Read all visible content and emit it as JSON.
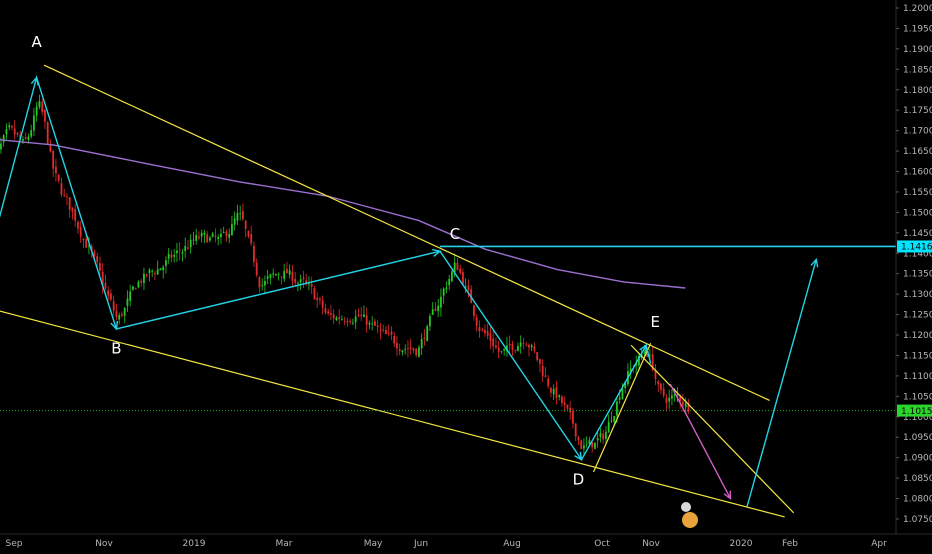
{
  "chart_data": {
    "type": "candlestick",
    "instrument_hint": "",
    "x_ticks": [
      "Sep",
      "Nov",
      "2019",
      "Mar",
      "May",
      "Jun",
      "Aug",
      "Oct",
      "Nov",
      "2020",
      "Feb",
      "Apr"
    ],
    "y_ticks": [
      "1.20000",
      "1.19500",
      "1.19000",
      "1.18500",
      "1.18000",
      "1.17500",
      "1.17000",
      "1.16500",
      "1.16000",
      "1.15500",
      "1.15000",
      "1.14500",
      "1.14000",
      "1.13500",
      "1.13000",
      "1.12500",
      "1.12000",
      "1.11500",
      "1.11000",
      "1.10500",
      "1.10000",
      "1.09500",
      "1.09000",
      "1.08500",
      "1.08000",
      "1.07500"
    ],
    "ylim": [
      1.0735,
      1.202
    ],
    "price_tags": [
      {
        "name": "resistance",
        "value": "1.14167",
        "bg": "#00e5ff",
        "fg": "#000000"
      },
      {
        "name": "last-price",
        "value": "1.10152",
        "bg": "#2bd62b",
        "fg": "#000000"
      }
    ],
    "wave_labels": [
      {
        "text": "A",
        "date": "2018-09-20",
        "price": 1.1905
      },
      {
        "text": "B",
        "date": "2018-11-12",
        "price": 1.1155
      },
      {
        "text": "C",
        "date": "2019-06-25",
        "price": 1.1435
      },
      {
        "text": "D",
        "date": "2019-09-15",
        "price": 1.0835
      },
      {
        "text": "E",
        "date": "2019-11-05",
        "price": 1.122
      }
    ],
    "colors": {
      "background": "#000000",
      "candle_up": "#26c926",
      "candle_down": "#e32c2c",
      "trendline": "#f4e842",
      "wave_path": "#22d3e6",
      "moving_average": "#9b6fd0",
      "projection": "#d35fc4",
      "last_price_line": "#1fa81f",
      "axis_text": "#b7b7b7"
    },
    "moving_average": [
      {
        "date": "2018-08-20",
        "price": 1.168
      },
      {
        "date": "2018-10-01",
        "price": 1.1665
      },
      {
        "date": "2018-12-01",
        "price": 1.162
      },
      {
        "date": "2019-02-01",
        "price": 1.1575
      },
      {
        "date": "2019-04-01",
        "price": 1.154
      },
      {
        "date": "2019-06-01",
        "price": 1.148
      },
      {
        "date": "2019-07-15",
        "price": 1.141
      },
      {
        "date": "2019-09-01",
        "price": 1.136
      },
      {
        "date": "2019-10-15",
        "price": 1.133
      },
      {
        "date": "2019-11-25",
        "price": 1.1315
      }
    ],
    "trendlines": [
      {
        "name": "upper-channel",
        "from": {
          "date": "2018-09-25",
          "price": 1.186
        },
        "to": {
          "date": "2020-01-20",
          "price": 1.104
        }
      },
      {
        "name": "lower-channel",
        "from": {
          "date": "2018-08-20",
          "price": 1.1265
        },
        "to": {
          "date": "2020-01-30",
          "price": 1.0755
        }
      },
      {
        "name": "wedge-upper",
        "from": {
          "date": "2019-10-20",
          "price": 1.1175
        },
        "to": {
          "date": "2020-02-05",
          "price": 1.0765
        }
      },
      {
        "name": "wedge-lower",
        "from": {
          "date": "2019-09-25",
          "price": 1.0865
        },
        "to": {
          "date": "2019-11-02",
          "price": 1.118
        }
      }
    ],
    "wave_path": [
      {
        "date": "2018-08-20",
        "price": 1.14
      },
      {
        "date": "2018-09-20",
        "price": 1.183
      },
      {
        "date": "2018-11-12",
        "price": 1.1215
      },
      {
        "date": "2019-06-15",
        "price": 1.1405
      },
      {
        "date": "2019-09-17",
        "price": 1.0895
      },
      {
        "date": "2019-10-30",
        "price": 1.1175
      },
      {
        "date": "2019-11-02",
        "price": 1.113
      }
    ],
    "projection_path": [
      {
        "date": "2019-11-15",
        "price": 1.108
      },
      {
        "date": "2019-12-25",
        "price": 1.08
      }
    ],
    "breakout_arrow": [
      {
        "date": "2020-01-05",
        "price": 1.078
      },
      {
        "date": "2020-02-20",
        "price": 1.1385
      }
    ],
    "resistance_line": {
      "from_date": "2019-06-15",
      "price": 1.14167
    },
    "last_price": 1.10152,
    "candle_anchors": [
      {
        "date": "2018-08-20",
        "price": 1.162
      },
      {
        "date": "2018-09-01",
        "price": 1.17
      },
      {
        "date": "2018-09-12",
        "price": 1.166
      },
      {
        "date": "2018-09-21",
        "price": 1.178
      },
      {
        "date": "2018-10-01",
        "price": 1.158
      },
      {
        "date": "2018-10-10",
        "price": 1.152
      },
      {
        "date": "2018-10-25",
        "price": 1.14
      },
      {
        "date": "2018-11-12",
        "price": 1.123
      },
      {
        "date": "2018-11-25",
        "price": 1.133
      },
      {
        "date": "2018-12-15",
        "price": 1.138
      },
      {
        "date": "2019-01-05",
        "price": 1.144
      },
      {
        "date": "2019-01-20",
        "price": 1.143
      },
      {
        "date": "2019-02-01",
        "price": 1.15
      },
      {
        "date": "2019-02-15",
        "price": 1.132
      },
      {
        "date": "2019-03-01",
        "price": 1.136
      },
      {
        "date": "2019-03-20",
        "price": 1.131
      },
      {
        "date": "2019-04-01",
        "price": 1.124
      },
      {
        "date": "2019-04-20",
        "price": 1.125
      },
      {
        "date": "2019-05-10",
        "price": 1.119
      },
      {
        "date": "2019-05-30",
        "price": 1.116
      },
      {
        "date": "2019-06-15",
        "price": 1.13
      },
      {
        "date": "2019-06-25",
        "price": 1.138
      },
      {
        "date": "2019-07-10",
        "price": 1.122
      },
      {
        "date": "2019-07-25",
        "price": 1.115
      },
      {
        "date": "2019-08-10",
        "price": 1.12
      },
      {
        "date": "2019-08-25",
        "price": 1.108
      },
      {
        "date": "2019-09-05",
        "price": 1.102
      },
      {
        "date": "2019-09-17",
        "price": 1.092
      },
      {
        "date": "2019-10-01",
        "price": 1.095
      },
      {
        "date": "2019-10-15",
        "price": 1.11
      },
      {
        "date": "2019-10-30",
        "price": 1.117
      },
      {
        "date": "2019-11-08",
        "price": 1.104
      },
      {
        "date": "2019-11-20",
        "price": 1.105
      },
      {
        "date": "2019-11-28",
        "price": 1.1015
      }
    ]
  }
}
